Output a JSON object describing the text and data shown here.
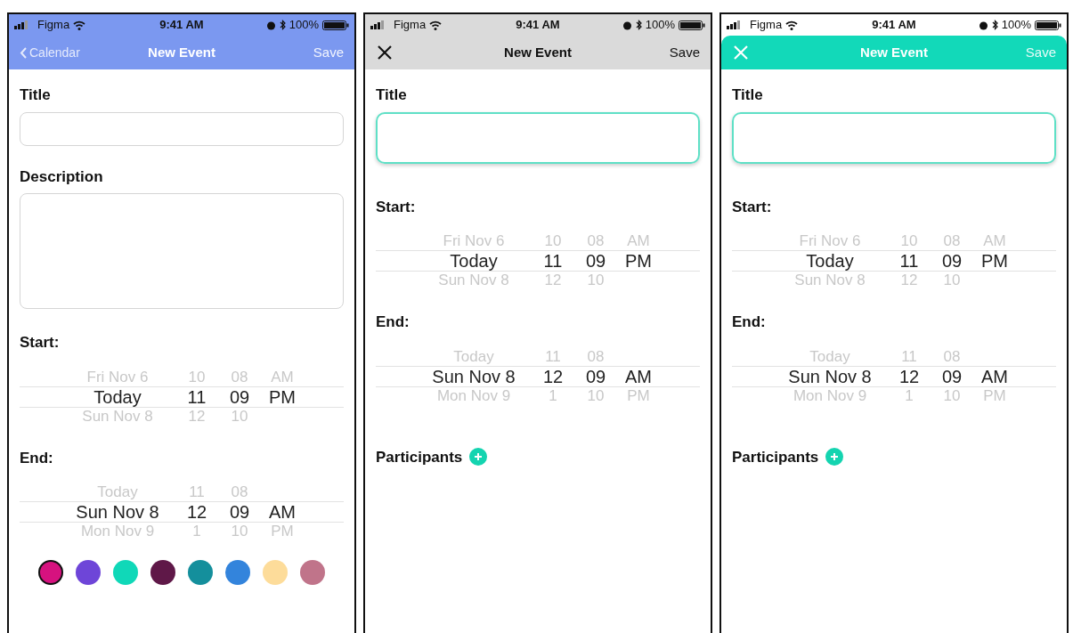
{
  "screens": [
    {
      "status_bar": {
        "carrier": "Figma",
        "time": "9:41 AM",
        "battery": "100%"
      },
      "nav": {
        "kind": "blue",
        "leading": {
          "kind": "back",
          "label": "Calendar"
        },
        "title": "New Event",
        "action": "Save"
      },
      "title_field": {
        "label": "Title",
        "focused": false
      },
      "description_field": {
        "label": "Description"
      },
      "start": {
        "label": "Start:",
        "rows": [
          {
            "selected": false,
            "date": "Fri Nov 6",
            "hour": "10",
            "minute": "08",
            "period": "AM"
          },
          {
            "selected": true,
            "date": "Today",
            "hour": "11",
            "minute": "09",
            "period": "PM"
          },
          {
            "selected": false,
            "date": "Sun Nov 8",
            "hour": "12",
            "minute": "10"
          }
        ]
      },
      "end": {
        "label": "End:",
        "rows": [
          {
            "selected": false,
            "date": "Today",
            "hour": "11",
            "minute": "08"
          },
          {
            "selected": true,
            "date": "Sun Nov 8",
            "hour": "12",
            "minute": "09",
            "period": "AM"
          },
          {
            "selected": false,
            "date": "Mon Nov 9",
            "hour": "1",
            "minute": "10",
            "period": "PM"
          }
        ]
      },
      "colors": [
        {
          "color": "#d6127f",
          "selected": true
        },
        {
          "color": "#6e45d8",
          "selected": false
        },
        {
          "color": "#10d8b8",
          "selected": false
        },
        {
          "color": "#5f1848",
          "selected": false
        },
        {
          "color": "#148f9c",
          "selected": false
        },
        {
          "color": "#3384dc",
          "selected": false
        },
        {
          "color": "#fddc9a",
          "selected": false
        },
        {
          "color": "#c0748a",
          "selected": false
        }
      ]
    },
    {
      "status_bar": {
        "carrier": "Figma",
        "time": "9:41 AM",
        "battery": "100%"
      },
      "nav": {
        "kind": "gray",
        "leading": {
          "kind": "close"
        },
        "title": "New Event",
        "action": "Save"
      },
      "title_field": {
        "label": "Title",
        "focused": true
      },
      "start": {
        "label": "Start:",
        "rows": [
          {
            "selected": false,
            "date": "Fri Nov 6",
            "hour": "10",
            "minute": "08",
            "period": "AM"
          },
          {
            "selected": true,
            "date": "Today",
            "hour": "11",
            "minute": "09",
            "period": "PM"
          },
          {
            "selected": false,
            "date": "Sun Nov 8",
            "hour": "12",
            "minute": "10"
          }
        ]
      },
      "end": {
        "label": "End:",
        "rows": [
          {
            "selected": false,
            "date": "Today",
            "hour": "11",
            "minute": "08"
          },
          {
            "selected": true,
            "date": "Sun Nov 8",
            "hour": "12",
            "minute": "09",
            "period": "AM"
          },
          {
            "selected": false,
            "date": "Mon Nov 9",
            "hour": "1",
            "minute": "10",
            "period": "PM"
          }
        ]
      },
      "participants": {
        "label": "Participants"
      }
    },
    {
      "status_bar": {
        "carrier": "Figma",
        "time": "9:41 AM",
        "battery": "100%"
      },
      "nav": {
        "kind": "teal",
        "leading": {
          "kind": "close"
        },
        "title": "New Event",
        "action": "Save"
      },
      "title_field": {
        "label": "Title",
        "focused": true
      },
      "start": {
        "label": "Start:",
        "rows": [
          {
            "selected": false,
            "date": "Fri Nov 6",
            "hour": "10",
            "minute": "08",
            "period": "AM"
          },
          {
            "selected": true,
            "date": "Today",
            "hour": "11",
            "minute": "09",
            "period": "PM"
          },
          {
            "selected": false,
            "date": "Sun Nov 8",
            "hour": "12",
            "minute": "10"
          }
        ]
      },
      "end": {
        "label": "End:",
        "rows": [
          {
            "selected": false,
            "date": "Today",
            "hour": "11",
            "minute": "08"
          },
          {
            "selected": true,
            "date": "Sun Nov 8",
            "hour": "12",
            "minute": "09",
            "period": "AM"
          },
          {
            "selected": false,
            "date": "Mon Nov 9",
            "hour": "1",
            "minute": "10",
            "period": "PM"
          }
        ]
      },
      "participants": {
        "label": "Participants"
      }
    }
  ]
}
